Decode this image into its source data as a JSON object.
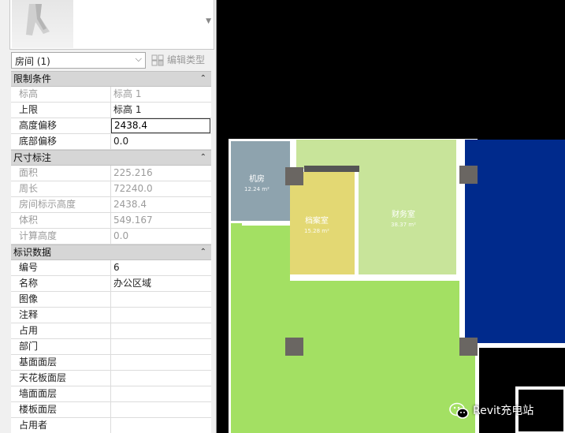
{
  "palette": {
    "type_selector": "房间 (1)",
    "edit_type_label": "编辑类型",
    "groups": [
      {
        "title": "限制条件",
        "rows": [
          {
            "label": "标高",
            "value": "标高 1",
            "readonly": true
          },
          {
            "label": "上限",
            "value": "标高 1",
            "readonly": false
          },
          {
            "label": "高度偏移",
            "value": "2438.4",
            "readonly": false,
            "editing": true
          },
          {
            "label": "底部偏移",
            "value": "0.0",
            "readonly": false
          }
        ]
      },
      {
        "title": "尺寸标注",
        "rows": [
          {
            "label": "面积",
            "value": "225.216",
            "readonly": true
          },
          {
            "label": "周长",
            "value": "72240.0",
            "readonly": true
          },
          {
            "label": "房间标示高度",
            "value": "2438.4",
            "readonly": true
          },
          {
            "label": "体积",
            "value": "549.167",
            "readonly": true
          },
          {
            "label": "计算高度",
            "value": "0.0",
            "readonly": true
          }
        ]
      },
      {
        "title": "标识数据",
        "rows": [
          {
            "label": "编号",
            "value": "6",
            "readonly": false
          },
          {
            "label": "名称",
            "value": "办公区域",
            "readonly": false
          },
          {
            "label": "图像",
            "value": "",
            "readonly": false
          },
          {
            "label": "注释",
            "value": "",
            "readonly": false
          },
          {
            "label": "占用",
            "value": "",
            "readonly": false
          },
          {
            "label": "部门",
            "value": "",
            "readonly": false
          },
          {
            "label": "基面面层",
            "value": "",
            "readonly": false
          },
          {
            "label": "天花板面层",
            "value": "",
            "readonly": false
          },
          {
            "label": "墙面面层",
            "value": "",
            "readonly": false
          },
          {
            "label": "楼板面层",
            "value": "",
            "readonly": false
          },
          {
            "label": "占用者",
            "value": "",
            "readonly": false
          }
        ]
      }
    ]
  },
  "plan": {
    "rooms": [
      {
        "name": "机房",
        "area": "12.24 m²",
        "color": "#8ea3ae"
      },
      {
        "name": "档案室",
        "area": "15.28 m²",
        "color": "#e3d873"
      },
      {
        "name": "财务室",
        "area": "38.37 m²",
        "color": "#c8e49a"
      },
      {
        "name": "办公区域",
        "color": "#a3e063"
      },
      {
        "name": "",
        "color": "#002a8c"
      }
    ]
  },
  "watermark": "Revit充电站",
  "icons": {
    "preview": "room-tag-preview-icon",
    "dropdown": "chevron-down-icon",
    "edit_type": "edit-type-icon",
    "collapse": "collapse-up-icon",
    "watermark": "wechat-icon"
  }
}
